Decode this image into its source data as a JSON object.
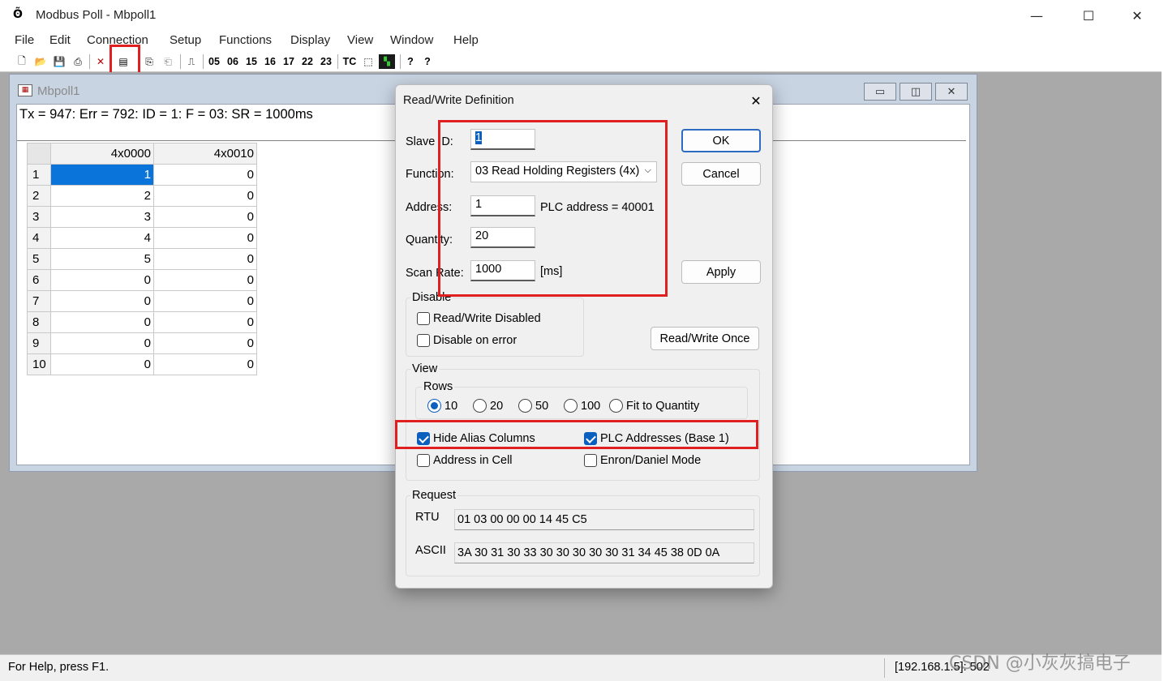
{
  "app": {
    "title": "Modbus Poll - Mbpoll1",
    "icon": "modbus-app-icon",
    "minimize": "—",
    "maximize": "☐",
    "close": "✕"
  },
  "menu": [
    "File",
    "Edit",
    "Connection",
    "Setup",
    "Functions",
    "Display",
    "View",
    "Window",
    "Help"
  ],
  "toolbar": {
    "icons": [
      "new-icon",
      "open-icon",
      "save-icon",
      "print-icon",
      "delete-icon",
      "read-write-definition-icon",
      "connect-icon",
      "disconnect-icon",
      "pulse-icon"
    ],
    "function_codes": [
      "05",
      "06",
      "15",
      "16",
      "17",
      "22",
      "23"
    ],
    "tc": "TC",
    "help": "?",
    "context_help": "?"
  },
  "child": {
    "title": "Mbpoll1",
    "status": "Tx = 947: Err = 792: ID = 1: F = 03: SR = 1000ms",
    "columns": [
      "4x0000",
      "4x0010"
    ],
    "rows": [
      {
        "n": "1",
        "a": "1",
        "b": "0"
      },
      {
        "n": "2",
        "a": "2",
        "b": "0"
      },
      {
        "n": "3",
        "a": "3",
        "b": "0"
      },
      {
        "n": "4",
        "a": "4",
        "b": "0"
      },
      {
        "n": "5",
        "a": "5",
        "b": "0"
      },
      {
        "n": "6",
        "a": "0",
        "b": "0"
      },
      {
        "n": "7",
        "a": "0",
        "b": "0"
      },
      {
        "n": "8",
        "a": "0",
        "b": "0"
      },
      {
        "n": "9",
        "a": "0",
        "b": "0"
      },
      {
        "n": "10",
        "a": "0",
        "b": "0"
      }
    ]
  },
  "dialog": {
    "title": "Read/Write Definition",
    "slave_id_label": "Slave ID:",
    "slave_id": "1",
    "function_label": "Function:",
    "function": "03 Read Holding Registers (4x)",
    "address_label": "Address:",
    "address": "1",
    "plc_address": "PLC address = 40001",
    "quantity_label": "Quantity:",
    "quantity": "20",
    "scan_rate_label": "Scan Rate:",
    "scan_rate": "1000",
    "scan_rate_unit": "[ms]",
    "ok": "OK",
    "cancel": "Cancel",
    "apply": "Apply",
    "read_write_once": "Read/Write Once",
    "disable_group": "Disable",
    "rw_disabled": "Read/Write Disabled",
    "disable_on_error": "Disable on error",
    "view_group": "View",
    "rows_group": "Rows",
    "rows_options": [
      "10",
      "20",
      "50",
      "100",
      "Fit to Quantity"
    ],
    "rows_selected": "10",
    "hide_alias": "Hide Alias Columns",
    "plc_addresses": "PLC Addresses (Base 1)",
    "address_in_cell": "Address in Cell",
    "enron": "Enron/Daniel Mode",
    "request_group": "Request",
    "rtu_label": "RTU",
    "rtu": "01 03 00 00 00 14 45 C5",
    "ascii_label": "ASCII",
    "ascii": "3A 30 31 30 33 30 30 30 30 30 31 34 45 38 0D 0A"
  },
  "statusbar": {
    "help": "For Help, press F1.",
    "connection": "[192.168.1.5]: 502"
  },
  "watermark": "CSDN @小灰灰搞电子",
  "colors": {
    "highlight_box": "#e02020",
    "selected_cell": "#0a74da",
    "checkbox_on": "#0a5fbf",
    "mdi_background": "#a9a9a9"
  }
}
